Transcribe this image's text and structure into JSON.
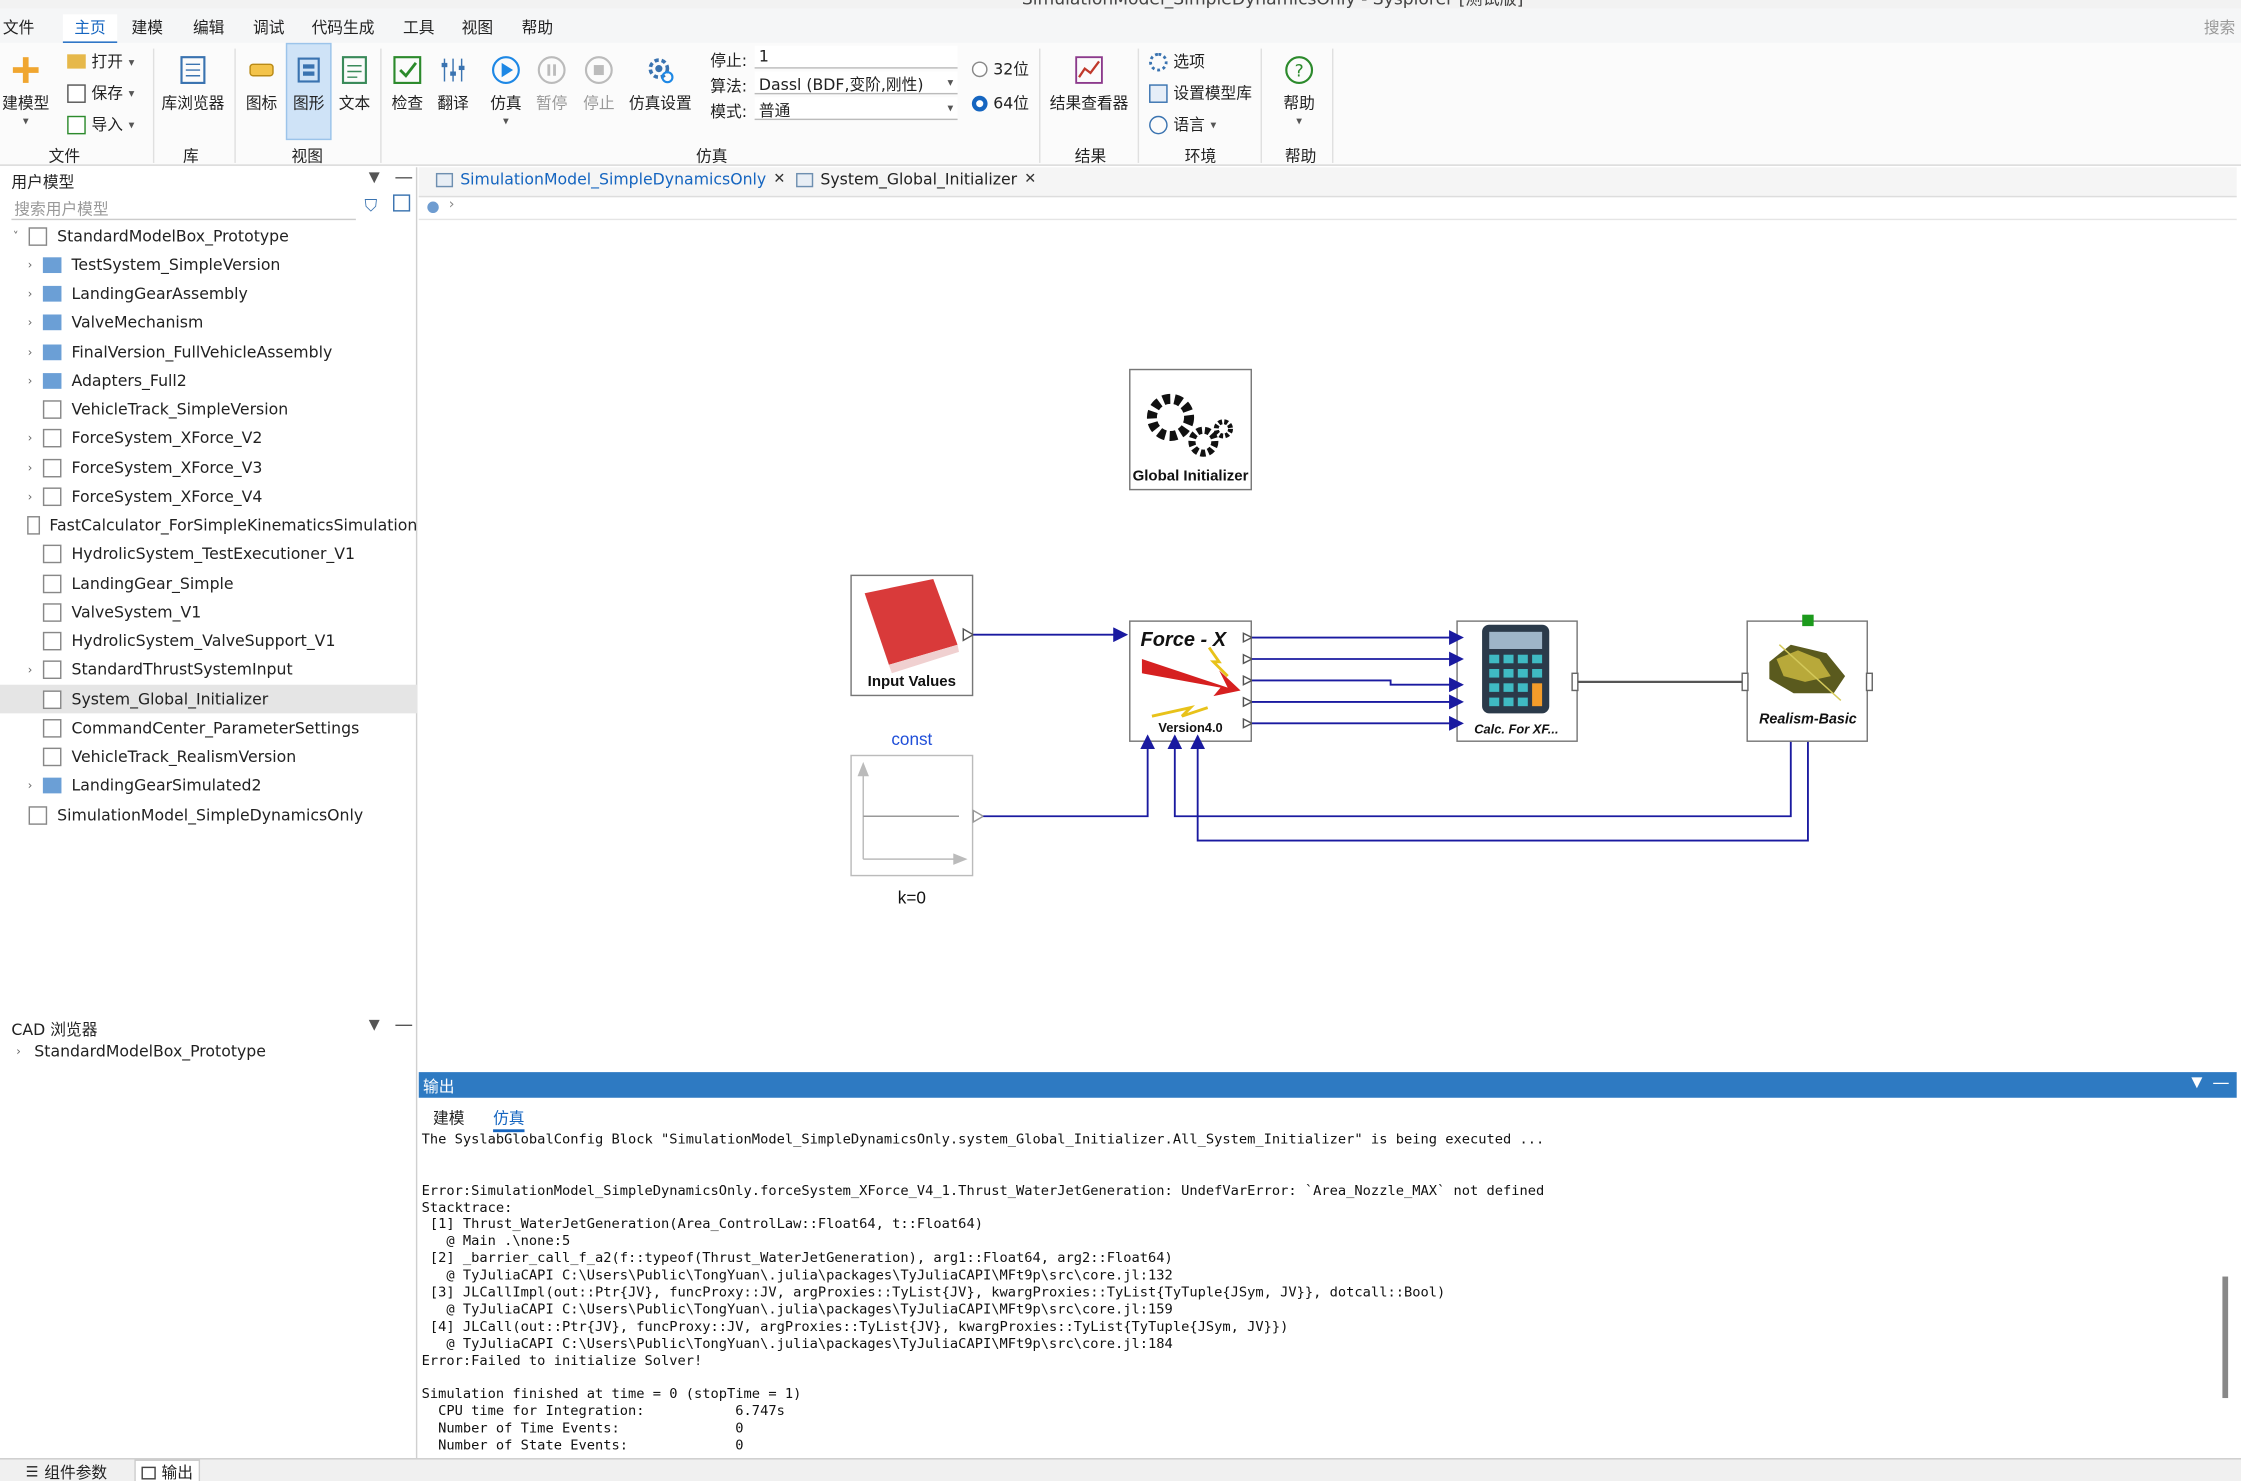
{
  "window_title": "SimulationModel_SimpleDynamicsOnly - Sysplorer [测试版]",
  "menu": {
    "items": [
      "文件",
      "主页",
      "建模",
      "编辑",
      "调试",
      "代码生成",
      "工具",
      "视图",
      "帮助"
    ],
    "active": "主页",
    "search": "搜索"
  },
  "ribbon": {
    "new_model": "新建模型",
    "new_model_visible": "建模型",
    "open": "打开",
    "save": "保存",
    "import": "导入",
    "group_file": "文件",
    "library_browser": "库浏览器",
    "group_library": "库",
    "icon": "图标",
    "diagram": "图形",
    "text": "文本",
    "group_view": "视图",
    "check": "检查",
    "translate": "翻译",
    "simulate": "仿真",
    "pause": "暂停",
    "stop": "停止",
    "sim_settings": "仿真设置",
    "stop_time_label": "停止:",
    "stop_time_value": "1",
    "algorithm_label": "算法:",
    "algorithm_value": "Dassl (BDF,变阶,刚性)",
    "mode_label": "模式:",
    "mode_value": "普通",
    "bit32": "32位",
    "bit64": "64位",
    "selected_bits": "64位",
    "group_sim": "仿真",
    "result_viewer": "结果查看器",
    "group_result": "结果",
    "options": "选项",
    "set_model_lib": "设置模型库",
    "language": "语言",
    "group_env": "环境",
    "help": "帮助",
    "group_help": "帮助"
  },
  "left_panel": {
    "title": "用户模型",
    "search_placeholder": "搜索用户模型",
    "root": "StandardModelBox_Prototype",
    "items": [
      {
        "label": "TestSystem_SimpleVersion",
        "kind": "folder",
        "expandable": true
      },
      {
        "label": "LandingGearAssembly",
        "kind": "folder",
        "expandable": true
      },
      {
        "label": "ValveMechanism",
        "kind": "folder",
        "expandable": true
      },
      {
        "label": "FinalVersion_FullVehicleAssembly",
        "kind": "folder",
        "expandable": true
      },
      {
        "label": "Adapters_Full2",
        "kind": "folder",
        "expandable": true
      },
      {
        "label": "VehicleTrack_SimpleVersion",
        "kind": "model",
        "expandable": false
      },
      {
        "label": "ForceSystem_XForce_V2",
        "kind": "model",
        "expandable": true
      },
      {
        "label": "ForceSystem_XForce_V3",
        "kind": "model",
        "expandable": true
      },
      {
        "label": "ForceSystem_XForce_V4",
        "kind": "model",
        "expandable": true
      },
      {
        "label": "FastCalculator_ForSimpleKinematicsSimulation",
        "kind": "model",
        "expandable": false
      },
      {
        "label": "HydrolicSystem_TestExecutioner_V1",
        "kind": "model",
        "expandable": false
      },
      {
        "label": "LandingGear_Simple",
        "kind": "model",
        "expandable": false
      },
      {
        "label": "ValveSystem_V1",
        "kind": "model",
        "expandable": false
      },
      {
        "label": "HydrolicSystem_ValveSupport_V1",
        "kind": "model",
        "expandable": false
      },
      {
        "label": "StandardThrustSystemInput",
        "kind": "model",
        "expandable": true
      },
      {
        "label": "System_Global_Initializer",
        "kind": "model",
        "expandable": false,
        "selected": true
      },
      {
        "label": "CommandCenter_ParameterSettings",
        "kind": "model",
        "expandable": false
      },
      {
        "label": "VehicleTrack_RealismVersion",
        "kind": "model",
        "expandable": false
      },
      {
        "label": "LandingGearSimulated2",
        "kind": "folder",
        "expandable": true
      }
    ],
    "second_root": "SimulationModel_SimpleDynamicsOnly",
    "cad_title": "CAD 浏览器",
    "cad_root": "StandardModelBox_Prototype"
  },
  "tabs": [
    {
      "label": "SimulationModel_SimpleDynamicsOnly",
      "active": true
    },
    {
      "label": "System_Global_Initializer",
      "active": false
    }
  ],
  "diagram": {
    "global_initializer": "Global Initializer",
    "input_values": "Input Values",
    "force_title": "Force - X",
    "force_version": "Version4.0",
    "calc_label": "Calc.  For  XF...",
    "realism_label": "Realism-Basic",
    "const_name": "const",
    "const_param": "k=0"
  },
  "output": {
    "title": "输出",
    "tabs": [
      "建模",
      "仿真"
    ],
    "active_tab": "仿真",
    "lines": [
      "The SyslabGlobalConfig Block \"SimulationModel_SimpleDynamicsOnly.system_Global_Initializer.All_System_Initializer\" is being executed ...",
      "",
      "",
      "Error:SimulationModel_SimpleDynamicsOnly.forceSystem_XForce_V4_1.Thrust_WaterJetGeneration: UndefVarError: `Area_Nozzle_MAX` not defined",
      "Stacktrace:",
      " [1] Thrust_WaterJetGeneration(Area_ControlLaw::Float64, t::Float64)",
      "   @ Main .\\none:5",
      " [2] _barrier_call_f_a2(f::typeof(Thrust_WaterJetGeneration), arg1::Float64, arg2::Float64)",
      "   @ TyJuliaCAPI C:\\Users\\Public\\TongYuan\\.julia\\packages\\TyJuliaCAPI\\MFt9p\\src\\core.jl:132",
      " [3] JLCallImpl(out::Ptr{JV}, funcProxy::JV, argProxies::TyList{JV}, kwargProxies::TyList{TyTuple{JSym, JV}}, dotcall::Bool)",
      "   @ TyJuliaCAPI C:\\Users\\Public\\TongYuan\\.julia\\packages\\TyJuliaCAPI\\MFt9p\\src\\core.jl:159",
      " [4] JLCall(out::Ptr{JV}, funcProxy::JV, argProxies::TyList{JV}, kwargProxies::TyList{TyTuple{JSym, JV}})",
      "   @ TyJuliaCAPI C:\\Users\\Public\\TongYuan\\.julia\\packages\\TyJuliaCAPI\\MFt9p\\src\\core.jl:184",
      "Error:Failed to initialize Solver!",
      "",
      "Simulation finished at time = 0 (stopTime = 1)",
      "  CPU time for Integration:           6.747s",
      "  Number of Time Events:              0",
      "  Number of State Events:             0"
    ]
  },
  "status_bar": {
    "component_params": "组件参数",
    "output": "输出"
  },
  "colors": {
    "accent": "#1565c0",
    "output_header": "#2e7ac2",
    "connector": "#1a1aa0"
  }
}
